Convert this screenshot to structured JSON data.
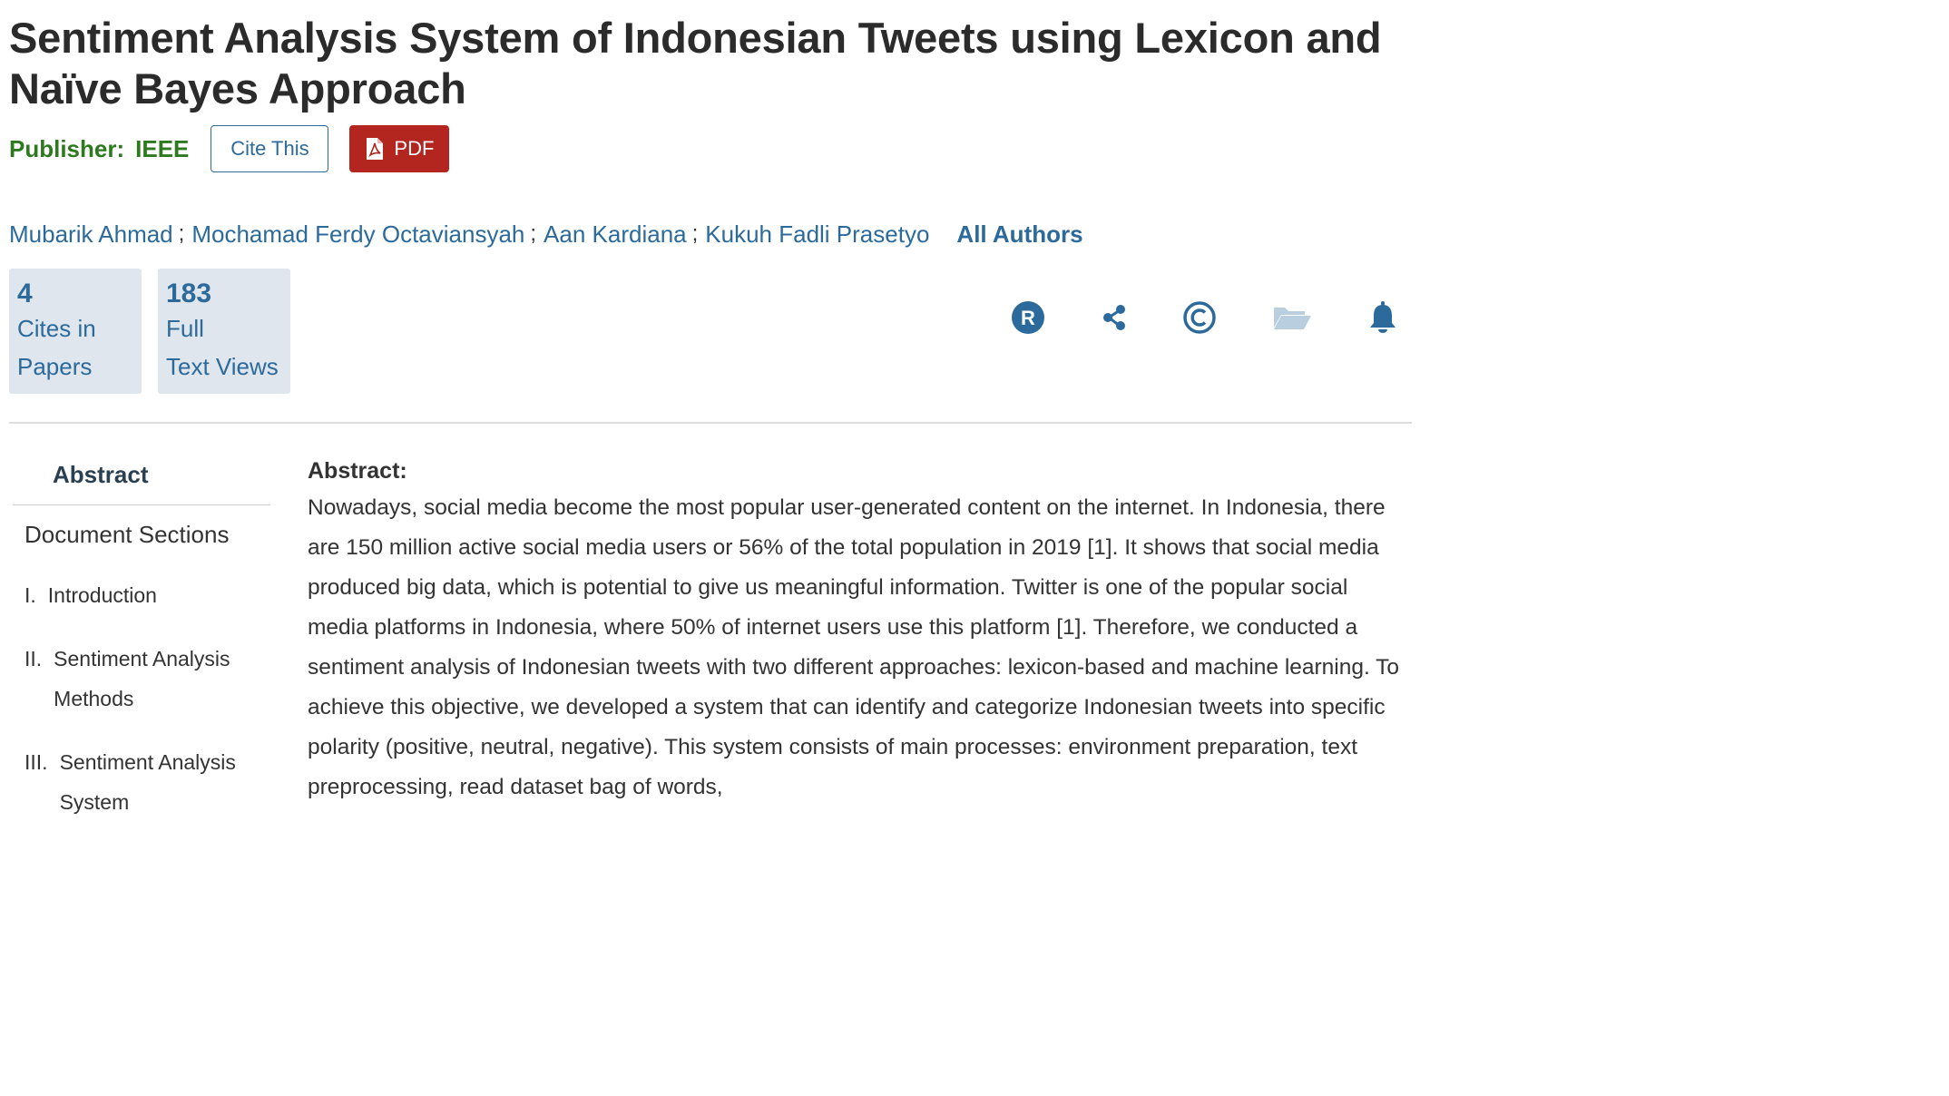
{
  "document": {
    "title": "Sentiment Analysis System of Indonesian Tweets using Lexicon and Naïve Bayes Approach"
  },
  "publisher": {
    "label": "Publisher:",
    "name": "IEEE"
  },
  "actions": {
    "cite_label": "Cite This",
    "pdf_label": "PDF"
  },
  "authors": {
    "list": [
      "Mubarik Ahmad",
      "Mochamad Ferdy Octaviansyah",
      "Aan Kardiana",
      "Kukuh Fadli Prasetyo"
    ],
    "separator": ";",
    "all_label": "All Authors"
  },
  "metrics": [
    {
      "value": "4",
      "label_line1": "Cites in",
      "label_line2": "Papers"
    },
    {
      "value": "183",
      "label_line1": "Full",
      "label_line2": "Text Views"
    }
  ],
  "toolbar_icons": [
    "rights-r-icon",
    "share-icon",
    "copyright-icon",
    "folder-icon",
    "bell-icon"
  ],
  "sidebar": {
    "abstract_tab": "Abstract",
    "sections_title": "Document Sections",
    "items": [
      {
        "num": "I.",
        "label": "Introduction"
      },
      {
        "num": "II.",
        "label": "Sentiment Analysis Methods"
      },
      {
        "num": "III.",
        "label": "Sentiment Analysis System"
      }
    ]
  },
  "abstract": {
    "heading": "Abstract:",
    "text": "Nowadays, social media become the most popular user-generated content on the internet. In Indonesia, there are 150 million active social media users or 56% of the total population in 2019 [1]. It shows that social media produced big data, which is potential to give us meaningful information. Twitter is one of the popular social media platforms in Indonesia, where 50% of internet users use this platform [1]. Therefore, we conducted a sentiment analysis of Indonesian tweets with two different approaches: lexicon-based and machine learning. To achieve this objective, we developed a system that can identify and categorize Indonesian tweets into specific polarity (positive, neutral, negative). This system consists of main processes: environment preparation, text preprocessing, read dataset bag of words,"
  },
  "colors": {
    "link": "#2c6a9c",
    "publisher": "#2d7a1e",
    "pdf": "#b2261f",
    "metric_bg": "#dfe6ed",
    "folder": "#b9cfe0"
  }
}
